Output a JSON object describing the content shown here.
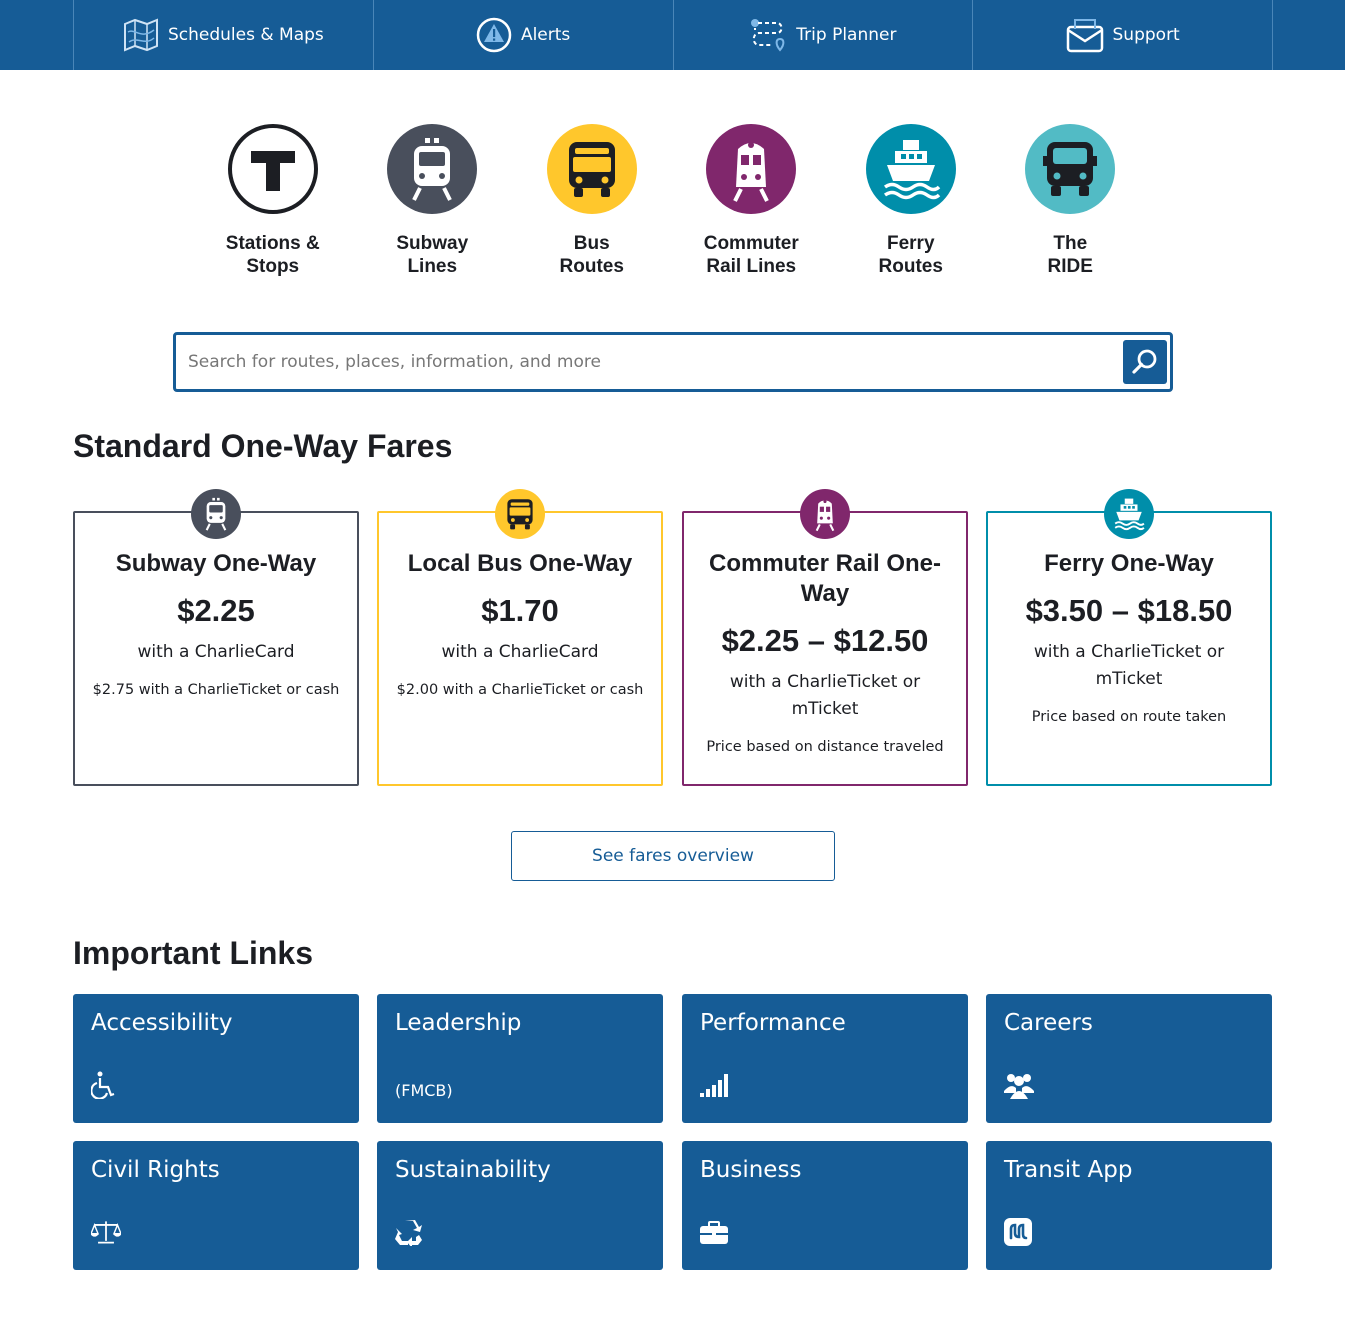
{
  "nav": {
    "items": [
      {
        "label": "Schedules & Maps",
        "icon": "map-icon"
      },
      {
        "label": "Alerts",
        "icon": "alert-icon"
      },
      {
        "label": "Trip Planner",
        "icon": "trip-planner-icon"
      },
      {
        "label": "Support",
        "icon": "support-icon"
      }
    ]
  },
  "modes": [
    {
      "label": "Stations &\nStops",
      "icon": "t-logo-icon",
      "color": "#ffffff"
    },
    {
      "label": "Subway\nLines",
      "icon": "subway-icon",
      "color": "#494f5c"
    },
    {
      "label": "Bus\nRoutes",
      "icon": "bus-icon",
      "color": "#ffc72c"
    },
    {
      "label": "Commuter\nRail Lines",
      "icon": "commuter-rail-icon",
      "color": "#80276c"
    },
    {
      "label": "Ferry\nRoutes",
      "icon": "ferry-icon",
      "color": "#008eaa"
    },
    {
      "label": "The\nRIDE",
      "icon": "ride-van-icon",
      "color": "#52bbc5"
    }
  ],
  "search": {
    "placeholder": "Search for routes, places, information, and more"
  },
  "fares": {
    "heading": "Standard One-Way Fares",
    "cards": [
      {
        "title": "Subway One-Way",
        "price": "$2.25",
        "with": "with a CharlieCard",
        "note": "$2.75 with a CharlieTicket or cash",
        "color": "#494f5c",
        "icon": "subway-icon"
      },
      {
        "title": "Local Bus One-Way",
        "price": "$1.70",
        "with": "with a CharlieCard",
        "note": "$2.00 with a CharlieTicket or cash",
        "color": "#ffc72c",
        "icon": "bus-icon"
      },
      {
        "title": "Commuter Rail One-Way",
        "price": "$2.25 – $12.50",
        "with": "with a CharlieTicket or mTicket",
        "note": "Price based on distance traveled",
        "color": "#80276c",
        "icon": "commuter-rail-icon"
      },
      {
        "title": "Ferry One-Way",
        "price": "$3.50 – $18.50",
        "with": "with a CharlieTicket or mTicket",
        "note": "Price based on route taken",
        "color": "#008eaa",
        "icon": "ferry-icon"
      }
    ],
    "overview_button": "See fares overview"
  },
  "links": {
    "heading": "Important Links",
    "items": [
      {
        "title": "Accessibility",
        "icon": "wheelchair-icon"
      },
      {
        "title": "Leadership",
        "sub": "(FMCB)"
      },
      {
        "title": "Performance",
        "icon": "signal-bars-icon"
      },
      {
        "title": "Careers",
        "icon": "people-group-icon"
      },
      {
        "title": "Civil Rights",
        "icon": "scales-icon"
      },
      {
        "title": "Sustainability",
        "icon": "recycle-icon"
      },
      {
        "title": "Business",
        "icon": "briefcase-icon"
      },
      {
        "title": "Transit App",
        "icon": "transit-app-icon"
      }
    ]
  }
}
